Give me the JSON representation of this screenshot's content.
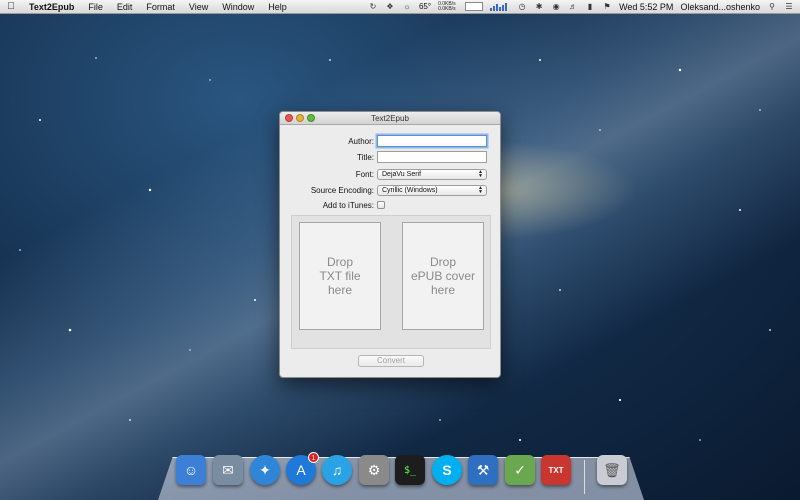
{
  "menubar": {
    "apple_icon": "apple-icon",
    "app_name": "Text2Epub",
    "menus": [
      "File",
      "Edit",
      "Format",
      "View",
      "Window",
      "Help"
    ],
    "temperature": "65°",
    "net_up": "0.0KB/s",
    "net_down": "0.0KB/s",
    "clock": "Wed 5:52 PM",
    "user": "Oleksand...oshenko"
  },
  "window": {
    "title": "Text2Epub",
    "author_label": "Author:",
    "author_value": "",
    "title_label": "Title:",
    "title_value": "",
    "font_label": "Font:",
    "font_value": "DejaVu Serif",
    "encoding_label": "Source Encoding:",
    "encoding_value": "Cyrillic (Windows)",
    "itunes_label": "Add to iTunes:",
    "itunes_checked": false,
    "drop_txt": "Drop\nTXT file\nhere",
    "drop_cover": "Drop\nePUB cover\nhere",
    "convert_label": "Convert"
  },
  "dock": {
    "items": [
      {
        "name": "finder-icon",
        "color": "#3d7fd6"
      },
      {
        "name": "mail-icon",
        "color": "#7a8da0"
      },
      {
        "name": "safari-icon",
        "color": "#2f86d8"
      },
      {
        "name": "app-store-icon",
        "color": "#1f79d9",
        "badge": "1"
      },
      {
        "name": "itunes-icon",
        "color": "#2aa3e6"
      },
      {
        "name": "system-preferences-icon",
        "color": "#8a8a8a"
      },
      {
        "name": "terminal-icon",
        "color": "#1d1d1d"
      },
      {
        "name": "skype-icon",
        "color": "#00aff0"
      },
      {
        "name": "xcode-icon",
        "color": "#2f6fc0"
      },
      {
        "name": "instruments-icon",
        "color": "#6aa84f"
      },
      {
        "name": "text2epub-icon",
        "color": "#c8362f",
        "label": "TXT"
      },
      {
        "name": "trash-icon",
        "color": "#c9ccd2"
      }
    ]
  }
}
